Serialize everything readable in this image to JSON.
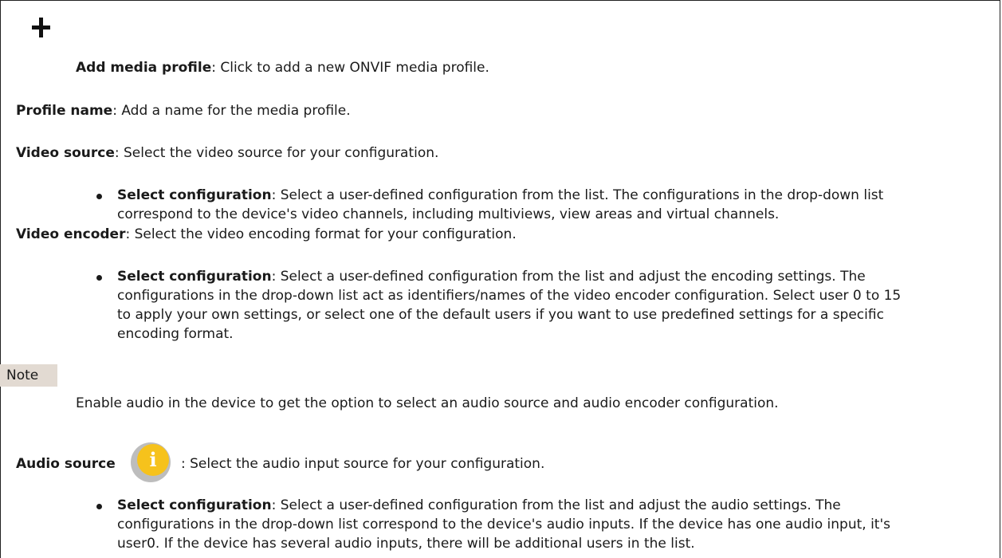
{
  "add_profile": {
    "term": "Add media profile",
    "desc": ": Click to add a new ONVIF media profile.",
    "icon": "plus-icon"
  },
  "profile_name": {
    "term": "Profile name",
    "desc": ": Add a name for the media profile."
  },
  "video_source": {
    "term": "Video source",
    "desc": ": Select the video source for your configuration.",
    "bullet": {
      "term": "Select configuration",
      "line1": ": Select a user-defined configuration from the list. The configurations in the drop-down list",
      "line2": "correspond to the device's video channels, including multiviews, view areas and virtual channels."
    }
  },
  "video_encoder": {
    "term": "Video encoder",
    "desc": ": Select the video encoding format for your configuration.",
    "bullet": {
      "term": "Select configuration",
      "line1": ": Select a user-defined configuration from the list and adjust the encoding settings. The",
      "line2": "configurations in the drop-down list act as identifiers/names of the video encoder configuration. Select user 0 to 15",
      "line3": "to apply your own settings, or select one of the default users if you want to use predefined settings for a specific",
      "line4": "encoding format."
    }
  },
  "note": {
    "label": "Note",
    "text": "Enable audio in the device to get the option to select an audio source and audio encoder configuration."
  },
  "audio_source": {
    "term": "Audio source",
    "desc": ": Select the audio input source for your configuration.",
    "icon": "info-icon",
    "icon_color": "#f6c21c",
    "bullet": {
      "term": "Select configuration",
      "line1": ": Select a user-defined configuration from the list and adjust the audio settings. The",
      "line2": "configurations in the drop-down list correspond to the device's audio inputs. If the device has one audio input, it's",
      "line3": "user0. If the device has several audio inputs, there will be additional users in the list."
    }
  }
}
